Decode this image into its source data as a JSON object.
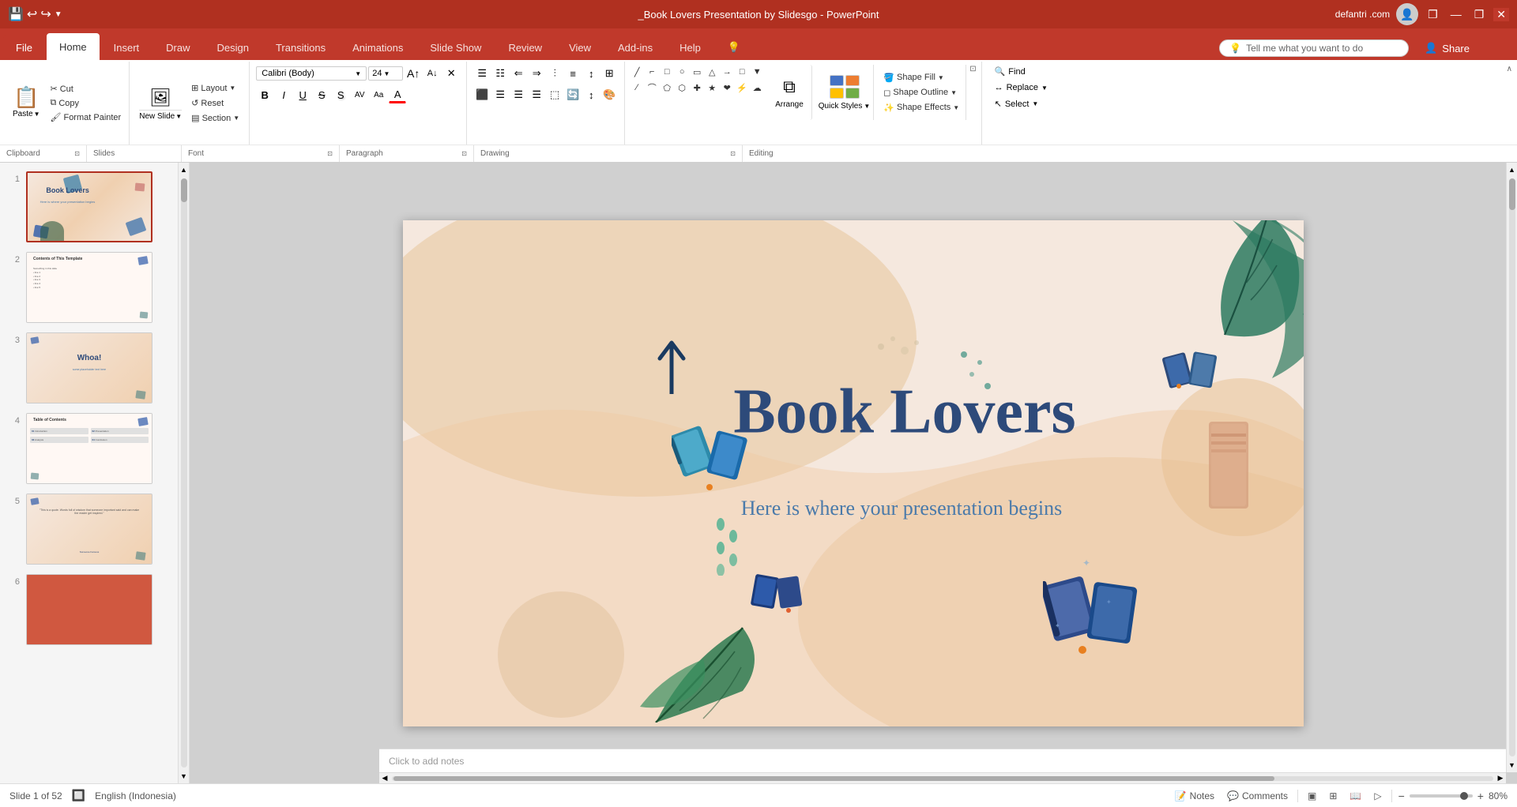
{
  "app": {
    "title": "_Book Lovers Presentation by Slidesgo - PowerPoint",
    "user": "defantri .com",
    "avatar_char": "👤"
  },
  "window_controls": {
    "minimize": "—",
    "maximize": "❐",
    "close": "✕",
    "restore": "❐"
  },
  "quick_access": {
    "save": "💾",
    "undo": "↩",
    "redo": "↪",
    "customize": "▼"
  },
  "tabs": [
    {
      "id": "file",
      "label": "File"
    },
    {
      "id": "home",
      "label": "Home",
      "active": true
    },
    {
      "id": "insert",
      "label": "Insert"
    },
    {
      "id": "draw",
      "label": "Draw"
    },
    {
      "id": "design",
      "label": "Design"
    },
    {
      "id": "transitions",
      "label": "Transitions"
    },
    {
      "id": "animations",
      "label": "Animations"
    },
    {
      "id": "slideshow",
      "label": "Slide Show"
    },
    {
      "id": "review",
      "label": "Review"
    },
    {
      "id": "view",
      "label": "View"
    },
    {
      "id": "addins",
      "label": "Add-ins"
    },
    {
      "id": "help",
      "label": "Help"
    },
    {
      "id": "lightbulb",
      "label": "💡"
    }
  ],
  "tell_me": {
    "placeholder": "Tell me what you want to do",
    "icon": "🔍"
  },
  "ribbon": {
    "clipboard": {
      "label": "Clipboard",
      "paste_label": "Paste",
      "cut_label": "Cut",
      "copy_label": "Copy",
      "format_painter_label": "Format Painter",
      "expand": "⊡"
    },
    "slides": {
      "label": "Slides",
      "new_slide_label": "New\nSlide",
      "layout_label": "Layout",
      "reset_label": "Reset",
      "section_label": "Section"
    },
    "font": {
      "label": "Font",
      "font_name": "Calibri (Body)",
      "font_size": "24",
      "bold": "B",
      "italic": "I",
      "underline": "U",
      "strikethrough": "S",
      "shadow": "S",
      "char_spacing": "AV",
      "change_case": "Aa",
      "font_color": "A",
      "expand": "⊡"
    },
    "paragraph": {
      "label": "Paragraph",
      "expand": "⊡"
    },
    "drawing": {
      "label": "Drawing",
      "arrange_label": "Arrange",
      "quick_styles_label": "Quick Styles",
      "shape_fill_label": "Shape Fill",
      "shape_outline_label": "Shape Outline",
      "shape_effects_label": "Shape Effects",
      "expand": "⊡"
    },
    "editing": {
      "label": "Editing",
      "find_label": "Find",
      "replace_label": "Replace",
      "select_label": "Select"
    }
  },
  "slide_panel": {
    "slides": [
      {
        "num": 1,
        "active": true,
        "bg": "#f5e8de",
        "has_content": true
      },
      {
        "num": 2,
        "active": false,
        "bg": "#f5f5f5",
        "has_content": true
      },
      {
        "num": 3,
        "active": false,
        "bg": "#f5e8de",
        "has_content": true
      },
      {
        "num": 4,
        "active": false,
        "bg": "#f5f5f5",
        "has_content": true
      },
      {
        "num": 5,
        "active": false,
        "bg": "#f5e8de",
        "has_content": true
      },
      {
        "num": 6,
        "active": false,
        "bg": "#e07050",
        "has_content": false
      }
    ]
  },
  "slide_canvas": {
    "title": "Book Lovers",
    "subtitle": "Here is where your presentation begins",
    "bg_color": "#f5e8de"
  },
  "status_bar": {
    "slide_info": "Slide 1 of 52",
    "language": "English (Indonesia)",
    "notes_label": "Notes",
    "comments_label": "Comments",
    "zoom_level": "80%",
    "normal_view": "▣",
    "outline_view": "≡",
    "slide_sorter": "⊞",
    "reading_view": "📄",
    "presenter_view": "▷"
  },
  "notes_placeholder": "Click to add notes"
}
